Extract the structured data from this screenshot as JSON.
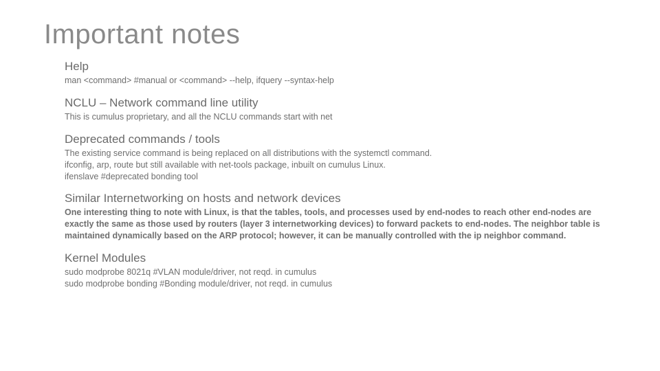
{
  "title": "Important notes",
  "sections": {
    "help": {
      "heading": "Help",
      "body": "man <command> #manual or <command> --help, ifquery --syntax-help"
    },
    "nclu": {
      "heading": "NCLU – Network command line utility",
      "body": "This is cumulus proprietary, and all the NCLU commands start with net"
    },
    "deprecated": {
      "heading": "Deprecated commands / tools",
      "line1": "The existing service command is being replaced on all distributions with the systemctl command.",
      "line2": "ifconfig, arp, route but still available with net-tools package, inbuilt on cumulus Linux.",
      "line3": "ifenslave    #deprecated bonding tool"
    },
    "similar": {
      "heading": "Similar Internetworking on hosts and network devices",
      "body": "One interesting thing to note with Linux, is that the tables, tools, and processes used by end-nodes to reach other end-nodes are exactly the same as those used by routers (layer 3 internetworking devices) to forward packets to end-nodes. The neighbor table is maintained dynamically based on the ARP protocol; however, it can be manually controlled with the ip neighbor command."
    },
    "kernel": {
      "heading": "Kernel Modules",
      "line1": "sudo modprobe 8021q    #VLAN module/driver, not reqd. in cumulus",
      "line2": "sudo modprobe bonding    #Bonding module/driver, not reqd. in cumulus"
    }
  }
}
